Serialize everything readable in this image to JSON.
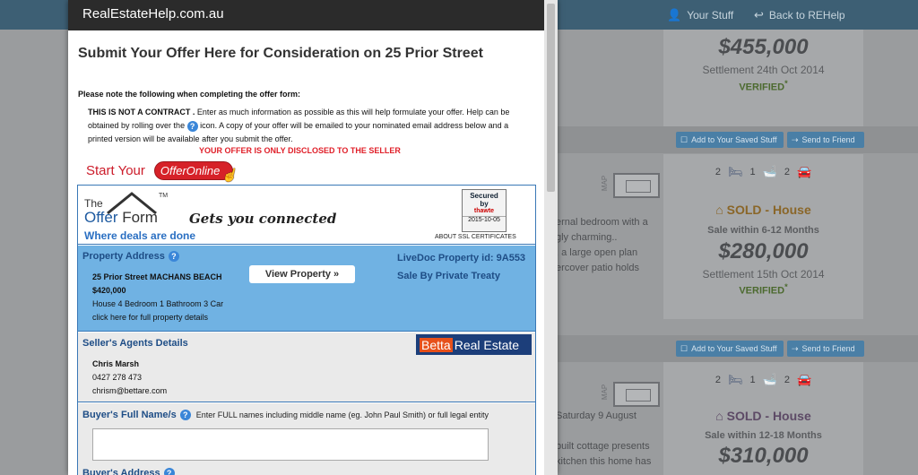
{
  "background": {
    "nav": {
      "your_stuff": "Your Stuff",
      "back": "Back to REHelp"
    },
    "buttons": {
      "save": "Add to Your Saved Stuff",
      "friend": "Send to Friend"
    },
    "map_label": "MAP",
    "listings": [
      {
        "price": "$455,000",
        "settlement": "Settlement 24th Oct 2014",
        "verified": "VERIFIED",
        "verified_mark": "*"
      },
      {
        "beds": "2",
        "baths": "1",
        "cars": "2",
        "sold": "SOLD - House",
        "sale_within": "Sale within 6-12 Months",
        "price": "$280,000",
        "settlement": "Settlement 15th Oct 2014",
        "verified": "VERIFIED",
        "verified_mark": "*",
        "snippet": [
          "ernal bedroom with a",
          "gly charming..",
          ", a large open plan",
          "ercover patio holds"
        ]
      },
      {
        "beds": "2",
        "baths": "1",
        "cars": "2",
        "sold": "SOLD - House",
        "sale_within": "Sale within 12-18 Months",
        "price": "$310,000",
        "snippet": [
          "Saturday 9 August",
          "",
          "built cottage presents",
          "kitchen this home has"
        ]
      }
    ]
  },
  "modal": {
    "site": "RealEstateHelp.com.au",
    "heading": "Submit Your Offer Here for Consideration on 25 Prior Street",
    "note": "Please note the following when completing the offer form:",
    "contract_bold": "THIS IS NOT A CONTRACT .",
    "contract_text_1": " Enter as much information as possible as this will help formulate your offer. Help can be obtained by rolling over the ",
    "contract_text_2": " icon. A copy of your offer will be emailed to your nominated email address below and a printed version will be available after you submit the offer.",
    "disclose": "YOUR OFFER IS ONLY DISCLOSED TO THE SELLER",
    "start": "Start Your",
    "offer_online": "OfferOnline"
  },
  "form": {
    "logo_the": "The",
    "logo_offer": "Offer",
    "logo_form": "Form",
    "logo_tm": "TM",
    "tagline": "Gets you connected",
    "deals": "Where deals are done",
    "ssl": {
      "secured": "Secured",
      "by": "by",
      "brand": "thawte",
      "date": "2015-10-05",
      "caption": "ABOUT SSL CERTIFICATES"
    },
    "property": {
      "label": "Property Address",
      "address": "25 Prior Street MACHANS BEACH",
      "price": "$420,000",
      "details": "House 4 Bedroom 1 Bathroom 3 Car",
      "link": "click here for full property details",
      "view_button": "View Property »",
      "livedoc": "LiveDoc Property id: 9A553",
      "sale_type": "Sale By Private Treaty"
    },
    "agent": {
      "label": "Seller's Agents Details",
      "logo_1": "Betta",
      "logo_2": "Real Estate",
      "name": "Chris Marsh",
      "phone": "0427 278 473",
      "email": "chrism@bettare.com"
    },
    "buyer": {
      "label": "Buyer's Full Name/s",
      "hint": "Enter FULL names including middle name (eg. John Paul Smith) or full legal entity",
      "value": "",
      "address_label": "Buyer's Address"
    }
  },
  "icons": {
    "help": "?",
    "bed": "🛏",
    "bath": "🛁",
    "car": "🚘",
    "house": "⌂",
    "user": "👤",
    "back": "↩",
    "save": "☐",
    "friend": "⇢"
  },
  "colors": {
    "modal_header": "#2b2b2b",
    "topbar": "#3d5f74",
    "property_bg": "#70b2e3",
    "disclose": "#e0202a",
    "offer_button": "#d62128"
  }
}
